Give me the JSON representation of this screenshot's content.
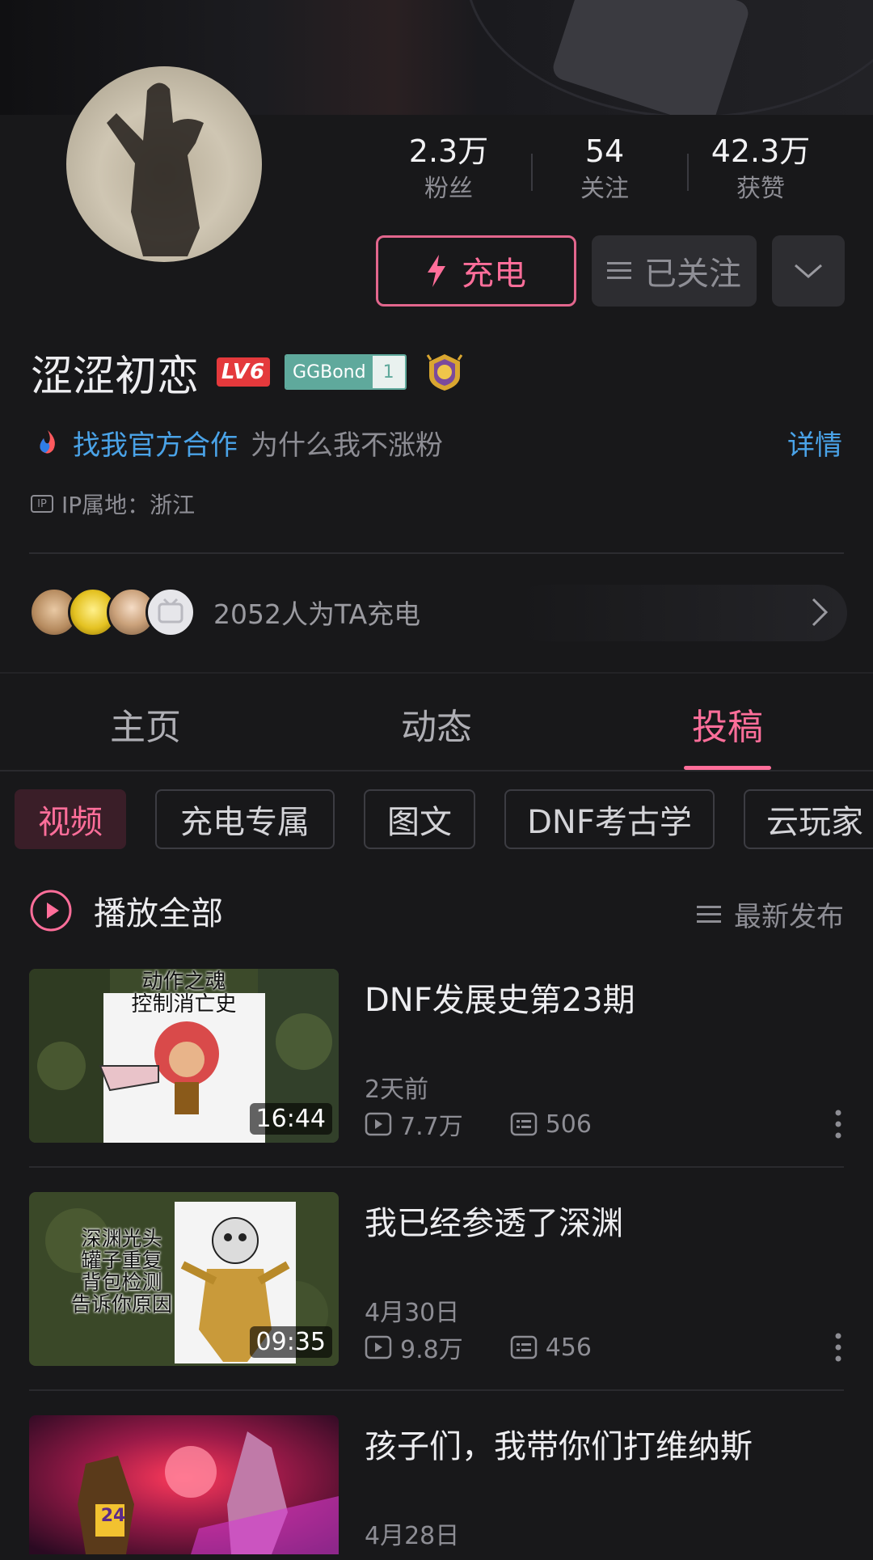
{
  "profile": {
    "name": "涩涩初恋",
    "level": "LV6",
    "fan_badge_name": "GGBond",
    "fan_badge_level": "1",
    "ip_label": "IP属地：浙江",
    "ip_icon_text": "IP"
  },
  "stats": [
    {
      "value": "2.3万",
      "label": "粉丝"
    },
    {
      "value": "54",
      "label": "关注"
    },
    {
      "value": "42.3万",
      "label": "获赞"
    }
  ],
  "actions": {
    "charge_label": "充电",
    "followed_label": "已关注"
  },
  "cooperation": {
    "link_text": "找我官方合作",
    "text": "为什么我不涨粉",
    "detail": "详情"
  },
  "supporters": {
    "text": "2052人为TA充电"
  },
  "tabs": [
    {
      "label": "主页",
      "active": false
    },
    {
      "label": "动态",
      "active": false
    },
    {
      "label": "投稿",
      "active": true
    }
  ],
  "chips": [
    {
      "label": "视频",
      "active": true
    },
    {
      "label": "充电专属",
      "active": false
    },
    {
      "label": "图文",
      "active": false
    },
    {
      "label": "DNF考古学",
      "active": false
    },
    {
      "label": "云玩家",
      "active": false
    }
  ],
  "list_header": {
    "play_all": "播放全部",
    "sort": "最新发布"
  },
  "videos": [
    {
      "title": "DNF发展史第23期",
      "date": "2天前",
      "views": "7.7万",
      "comments": "506",
      "duration": "16:44",
      "thumb_caption": [
        "动作之魂",
        "控制消亡史"
      ]
    },
    {
      "title": "我已经参透了深渊",
      "date": "4月30日",
      "views": "9.8万",
      "comments": "456",
      "duration": "09:35",
      "thumb_caption": [
        "深渊光头",
        "罐子重复",
        "背包检测",
        "告诉你原因"
      ]
    },
    {
      "title": "孩子们，我带你们打维纳斯",
      "date": "4月28日",
      "thumb_caption": [
        "24"
      ]
    }
  ],
  "colors": {
    "accent_pink": "#ff6e9a",
    "link_blue": "#4aa3e8",
    "background": "#18181a"
  }
}
